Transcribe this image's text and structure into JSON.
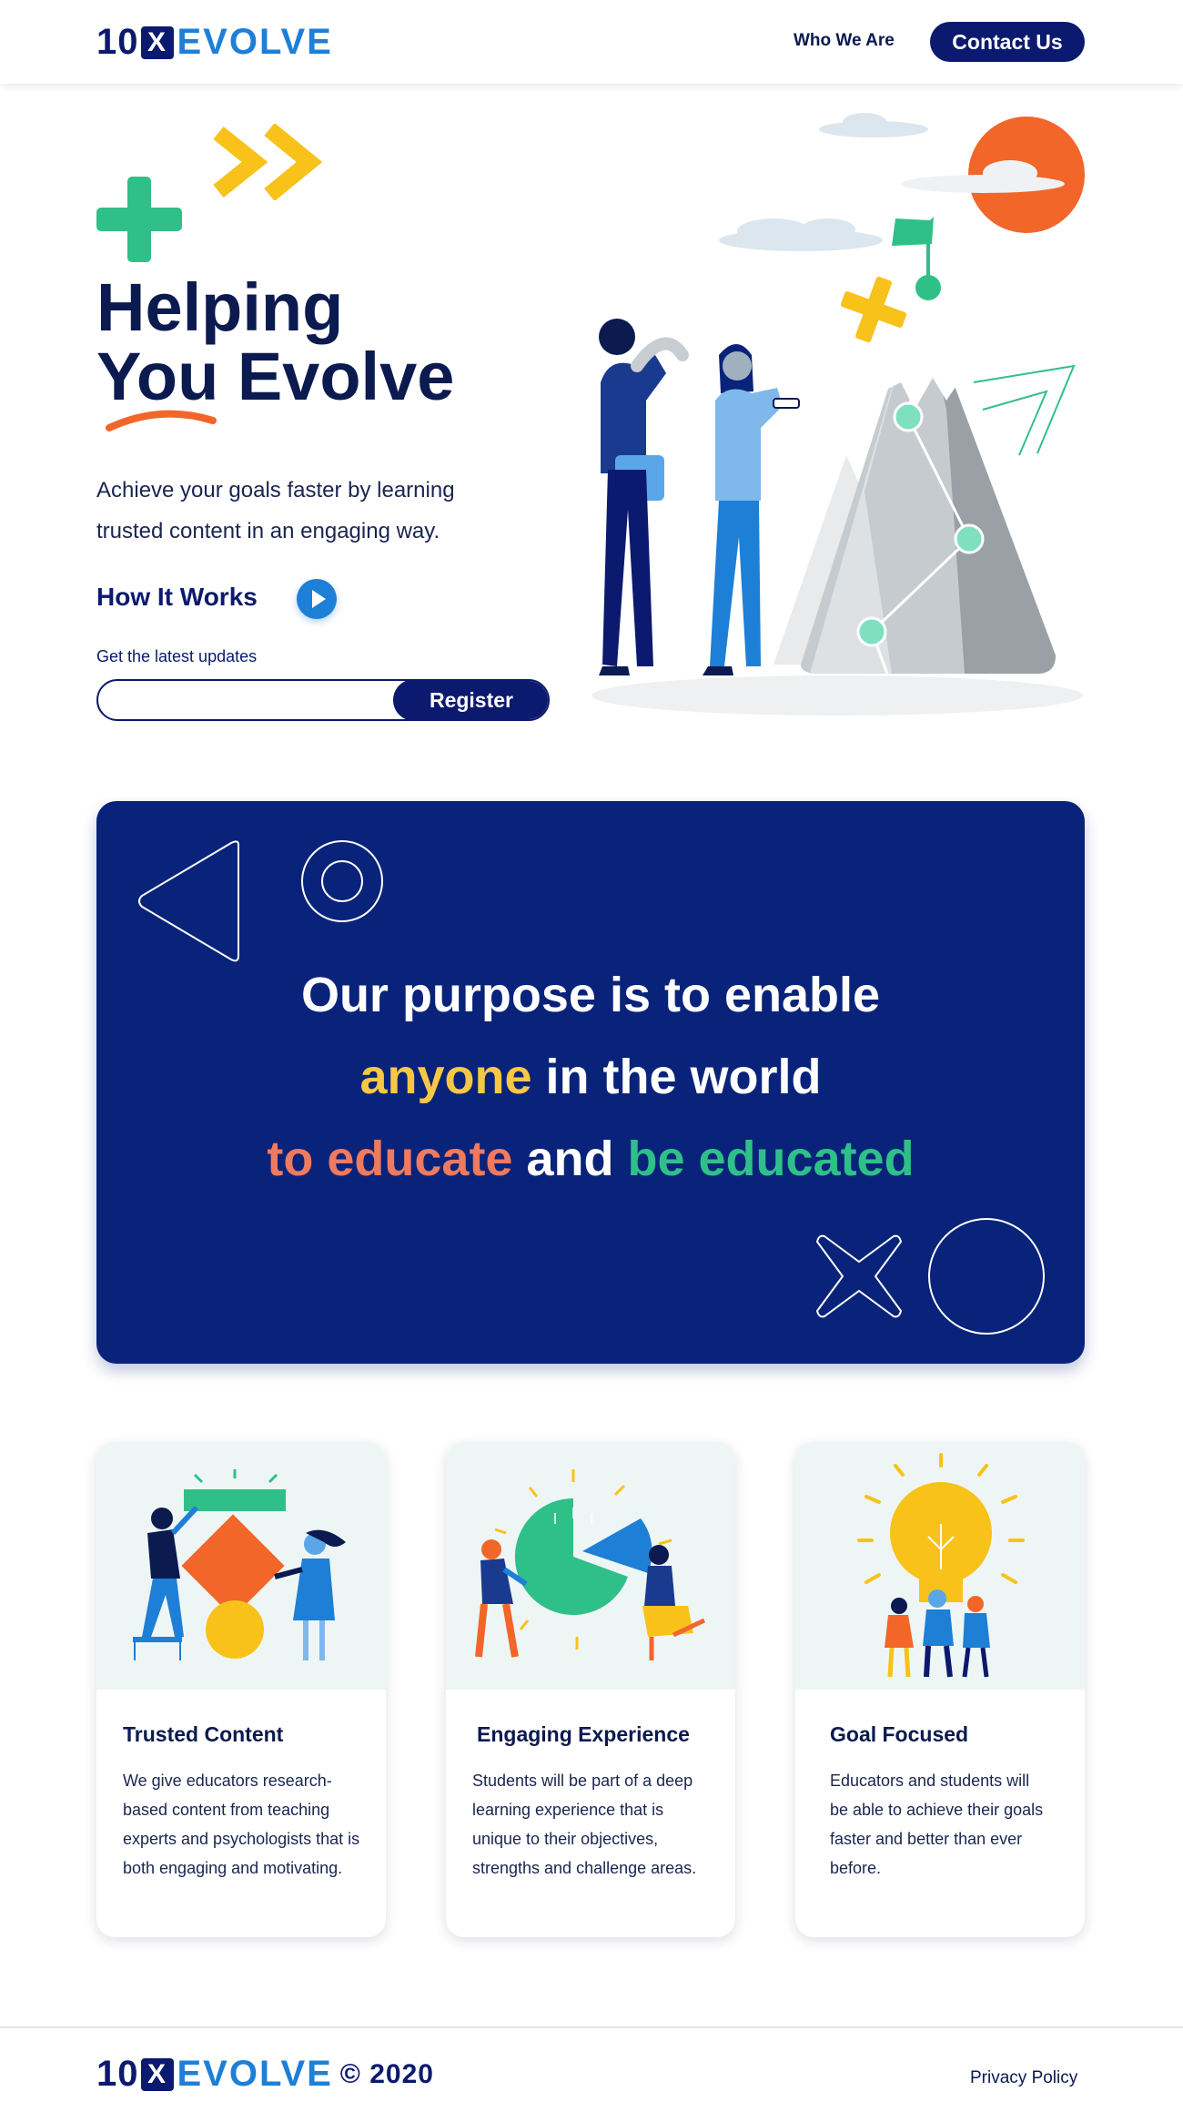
{
  "nav": {
    "logo_num": "10",
    "logo_x": "X",
    "logo_word": "EVOLVE",
    "who_we_are": "Who We Are",
    "contact_us": "Contact Us"
  },
  "hero": {
    "title_line1": "Helping",
    "title_line2": "You Evolve",
    "subtitle": "Achieve your goals faster by learning trusted content in an engaging way.",
    "how_it_works": "How It Works",
    "updates_label": "Get the latest updates",
    "email_placeholder": "",
    "register": "Register"
  },
  "purpose": {
    "line1": "Our purpose is to enable",
    "line2_highlight": "anyone",
    "line2_rest": " in the world",
    "line3_part1": "to educate",
    "line3_part2": " and ",
    "line3_part3": "be educated"
  },
  "features": [
    {
      "title": "Trusted Content",
      "body": "We give educators research-based content from teaching experts and psychologists that is both engaging and motivating."
    },
    {
      "title": "Engaging Experience",
      "body": "Students will be part of a deep learning experience that is unique to their objectives, strengths and challenge areas."
    },
    {
      "title": "Goal Focused",
      "body": "Educators and students will be able to achieve their goals faster and better than ever before."
    }
  ],
  "footer": {
    "logo_num": "10",
    "logo_x": "X",
    "logo_word": "EVOLVE",
    "copyright": "© 2020",
    "privacy": "Privacy Policy"
  },
  "colors": {
    "navy": "#0b1a6e",
    "blue": "#1e7fd6",
    "banner": "#0a237a",
    "yellow": "#f8c844",
    "orange": "#f07a5e",
    "green": "#2fc08a"
  }
}
